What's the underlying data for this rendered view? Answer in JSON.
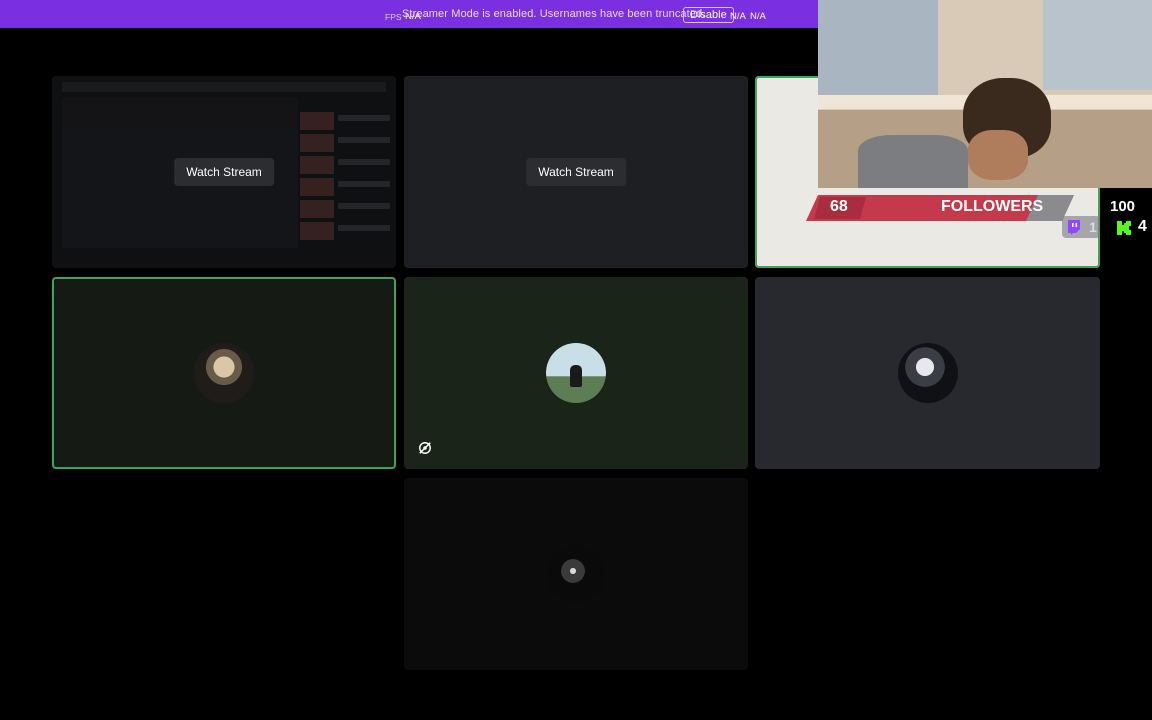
{
  "banner": {
    "fps_label": "FPS",
    "na_1": "N/A",
    "na_2": "N/A",
    "message": "Streamer Mode is enabled. Usernames have been truncated.",
    "disable_label": "Disable",
    "color": "#7a2fe0"
  },
  "tiles": [
    {
      "id": "stream-1",
      "watch_label": "Watch Stream"
    },
    {
      "id": "stream-2",
      "watch_label": "Watch Stream"
    },
    {
      "id": "camera",
      "speaking": true
    },
    {
      "id": "user-1",
      "speaking": true
    },
    {
      "id": "user-2",
      "muted_video": true
    },
    {
      "id": "user-3"
    },
    {
      "id": "user-4"
    }
  ],
  "overlay": {
    "followers_count": "68",
    "followers_label": "FOLLOWERS",
    "twitch_count": "1",
    "top_count": "100",
    "kick_count": "4",
    "band_color": "#c43a4c",
    "kick_color": "#53fc18",
    "twitch_color": "#9146ff"
  },
  "colors": {
    "speaking_ring": "#3ba55d",
    "background": "#000000"
  },
  "icons": [
    "camera-off-icon",
    "twitch-icon",
    "kick-icon"
  ]
}
